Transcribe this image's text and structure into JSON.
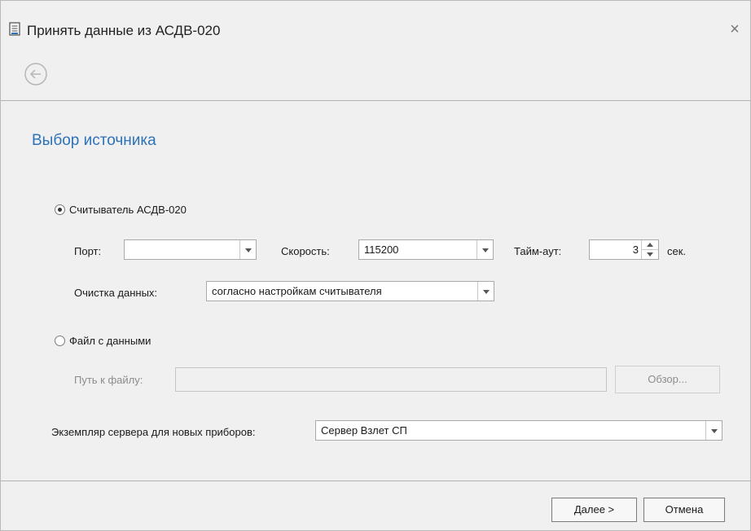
{
  "window": {
    "title": "Принять данные из АСДВ-020",
    "close_symbol": "×",
    "icons": {
      "title": "document-icon",
      "back": "back-arrow-icon",
      "close": "close-icon"
    }
  },
  "page": {
    "section_title": "Выбор источника"
  },
  "source_reader": {
    "radio_label": "Считыватель АСДВ-020",
    "selected": true,
    "port": {
      "label": "Порт:",
      "value": ""
    },
    "speed": {
      "label": "Скорость:",
      "value": "115200"
    },
    "timeout": {
      "label": "Тайм-аут:",
      "value": "3",
      "unit": "сек."
    },
    "clear_data": {
      "label": "Очистка данных:",
      "value": "согласно настройкам считывателя"
    }
  },
  "source_file": {
    "radio_label": "Файл с данными",
    "selected": false,
    "path": {
      "label": "Путь к файлу:",
      "value": ""
    },
    "browse_label": "Обзор..."
  },
  "server": {
    "label": "Экземпляр сервера для новых приборов:",
    "value": "Сервер Взлет СП"
  },
  "footer": {
    "next_label": "Далее >",
    "cancel_label": "Отмена"
  },
  "colors": {
    "section_title": "#2c73b8",
    "background": "#f0f0f0"
  }
}
